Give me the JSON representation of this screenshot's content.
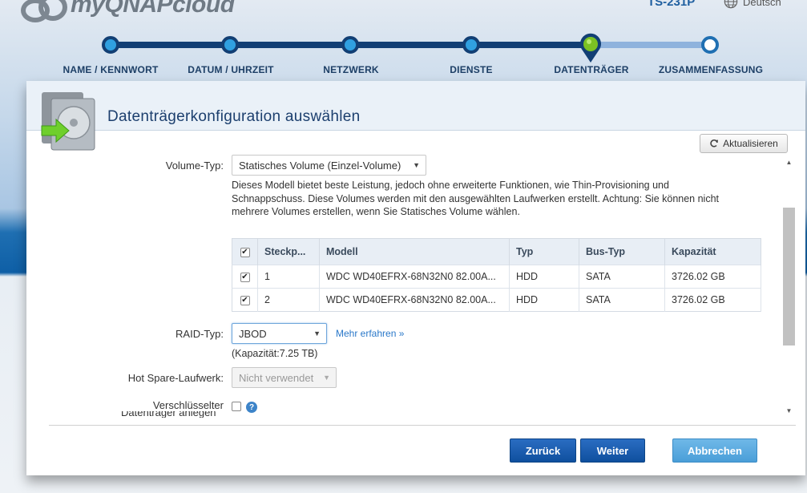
{
  "header": {
    "logo_text": "myQNAPcloud",
    "model": "TS-231P",
    "language": "Deutsch"
  },
  "wizard": {
    "steps": [
      {
        "label": "NAME / KENNWORT"
      },
      {
        "label": "DATUM / UHRZEIT"
      },
      {
        "label": "NETZWERK"
      },
      {
        "label": "DIENSTE"
      },
      {
        "label": "DATENTRÄGER"
      },
      {
        "label": "ZUSAMMENFASSUNG"
      }
    ],
    "current_step": 5,
    "total_steps": 6
  },
  "panel": {
    "title": "Datenträgerkonfiguration auswählen",
    "refresh_label": "Aktualisieren"
  },
  "form": {
    "volume_type_label": "Volume-Typ:",
    "volume_type_value": "Statisches Volume (Einzel-Volume)",
    "description": "Dieses Modell bietet beste Leistung, jedoch ohne erweiterte Funktionen, wie Thin-Provisioning und Schnappschuss. Diese Volumes werden mit den ausgewählten Laufwerken erstellt. Achtung: Sie können nicht mehrere Volumes erstellen, wenn Sie Statisches Volume wählen.",
    "raid_type_label": "RAID-Typ:",
    "raid_type_value": "JBOD",
    "learn_more": "Mehr erfahren »",
    "capacity_text": "(Kapazität:7.25 TB)",
    "hot_spare_label": "Hot Spare-Laufwerk:",
    "hot_spare_value": "Nicht verwendet",
    "encrypted_label": "Verschlüsselter",
    "encrypted_label_cut": "Datenträger anlegen"
  },
  "disk_table": {
    "headers": [
      "Steckp...",
      "Modell",
      "Typ",
      "Bus-Typ",
      "Kapazität"
    ],
    "rows": [
      {
        "slot": "1",
        "model": "WDC WD40EFRX-68N32N0 82.00A...",
        "type": "HDD",
        "bus": "SATA",
        "capacity": "3726.02 GB",
        "checked": true
      },
      {
        "slot": "2",
        "model": "WDC WD40EFRX-68N32N0 82.00A...",
        "type": "HDD",
        "bus": "SATA",
        "capacity": "3726.02 GB",
        "checked": true
      }
    ]
  },
  "buttons": {
    "back": "Zurück",
    "next": "Weiter",
    "cancel": "Abbrechen"
  },
  "colors": {
    "wizard_done": "#123f74",
    "wizard_current": "#7cc223",
    "primary_button": "#0f4f9e",
    "cancel_button": "#4a9ed8"
  }
}
